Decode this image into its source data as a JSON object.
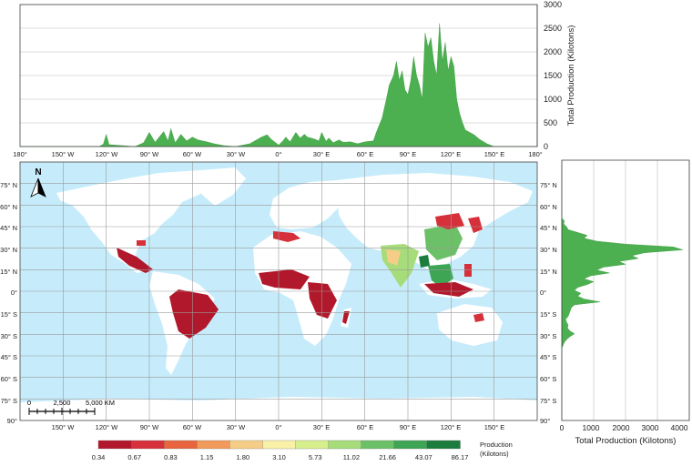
{
  "top_chart": {
    "ylabel": "Total Production (Kilotons)",
    "y_ticks": [
      "0",
      "500",
      "1000",
      "1500",
      "2000",
      "2500",
      "3000"
    ],
    "x_ticks": [
      "180°",
      "150° W",
      "120° W",
      "90° W",
      "60° W",
      "30° W",
      "0°",
      "30° E",
      "60° E",
      "90° E",
      "120° E",
      "150° E",
      "180°"
    ]
  },
  "right_chart": {
    "xlabel": "Total Production (Kilotons)",
    "x_ticks": [
      "0",
      "1000",
      "2000",
      "3000",
      "4000"
    ],
    "y_ticks": [
      "75° N",
      "60° N",
      "45° N",
      "30° N",
      "15° N",
      "0°",
      "15° S",
      "30° S",
      "45° S",
      "60° S",
      "75° S",
      "90° S"
    ]
  },
  "map": {
    "north_label": "N",
    "lat_labels": [
      "75° N",
      "60° N",
      "45° N",
      "30° N",
      "15° N",
      "0°",
      "15° S",
      "30° S",
      "45° S",
      "60° S",
      "75° S",
      "90°"
    ],
    "lon_labels": [
      "150° W",
      "120° W",
      "90° W",
      "60° W",
      "30° W",
      "0°",
      "30° E",
      "60° E",
      "90° E",
      "120° E",
      "150° E"
    ],
    "scale_labels": [
      "0",
      "2,500",
      "5,000 KM"
    ],
    "ocean_color": "#c6ecfb",
    "land_color": "#ffffff"
  },
  "legend": {
    "title_line1": "Production",
    "title_line2": "(Kilotons)",
    "breaks": [
      "0.34",
      "0.67",
      "0.83",
      "1.15",
      "1.80",
      "3.10",
      "5.73",
      "11.02",
      "21.66",
      "43.07",
      "86.17"
    ],
    "colors": [
      "#b2182b",
      "#d6303b",
      "#e8653f",
      "#f19a5b",
      "#f6cd86",
      "#f9f1a8",
      "#d8ef8e",
      "#a6dc7a",
      "#6cc067",
      "#3ea555",
      "#1b7c3d"
    ]
  },
  "chart_data": [
    {
      "type": "area",
      "title": "",
      "xlabel": "",
      "ylabel": "Total Production (Kilotons)",
      "xlim": [
        -180,
        180
      ],
      "ylim": [
        0,
        3000
      ],
      "series": [
        {
          "x": [
            -180,
            -125,
            -122,
            -120,
            -118,
            -100,
            -94,
            -90,
            -86,
            -80,
            -77,
            -75,
            -72,
            -68,
            -64,
            -60,
            -56,
            -50,
            -45,
            -38,
            -30,
            -20,
            -12,
            -8,
            -5,
            -2,
            0,
            3,
            5,
            8,
            12,
            15,
            18,
            20,
            25,
            28,
            30,
            33,
            35,
            38,
            42,
            45,
            50,
            55,
            60,
            66,
            68,
            72,
            75,
            77,
            80,
            82,
            84,
            86,
            88,
            90,
            92,
            94,
            96,
            98,
            100,
            102,
            104,
            106,
            108,
            110,
            112,
            114,
            116,
            118,
            120,
            122,
            124,
            126,
            128,
            130,
            133,
            136,
            140,
            145,
            150,
            180
          ],
          "y": [
            0,
            0,
            50,
            260,
            40,
            0,
            80,
            300,
            90,
            320,
            120,
            380,
            80,
            260,
            120,
            200,
            140,
            100,
            60,
            20,
            0,
            60,
            200,
            250,
            150,
            80,
            30,
            120,
            200,
            100,
            300,
            180,
            260,
            200,
            160,
            120,
            300,
            110,
            180,
            80,
            140,
            90,
            100,
            60,
            100,
            120,
            300,
            600,
            1000,
            1300,
            1500,
            1800,
            1400,
            1600,
            1200,
            1100,
            1400,
            1900,
            1500,
            1300,
            1000,
            2400,
            2100,
            2300,
            1800,
            1500,
            2600,
            1800,
            2200,
            1600,
            1900,
            1700,
            1000,
            700,
            500,
            350,
            300,
            250,
            150,
            60,
            0,
            0
          ]
        }
      ]
    },
    {
      "type": "area",
      "title": "",
      "xlabel": "Total Production (Kilotons)",
      "ylabel": "",
      "xlim": [
        0,
        4000
      ],
      "ylim": [
        -90,
        90
      ],
      "series": [
        {
          "lat": [
            90,
            50,
            48,
            46,
            44,
            42,
            40,
            38,
            36,
            34,
            32,
            30,
            28,
            26,
            24,
            22,
            20,
            18,
            16,
            14,
            12,
            10,
            8,
            6,
            4,
            2,
            0,
            -2,
            -4,
            -6,
            -8,
            -10,
            -12,
            -15,
            -18,
            -20,
            -22,
            -24,
            -26,
            -28,
            -30,
            -32,
            -34,
            -36,
            -40,
            -90
          ],
          "value": [
            0,
            0,
            80,
            60,
            150,
            200,
            500,
            800,
            700,
            1100,
            2000,
            3500,
            3800,
            2600,
            2200,
            2400,
            1800,
            2000,
            1300,
            1100,
            1500,
            900,
            700,
            1000,
            800,
            500,
            400,
            600,
            500,
            700,
            1200,
            400,
            300,
            250,
            200,
            120,
            150,
            200,
            180,
            250,
            400,
            260,
            150,
            80,
            0,
            0
          ]
        }
      ]
    }
  ]
}
